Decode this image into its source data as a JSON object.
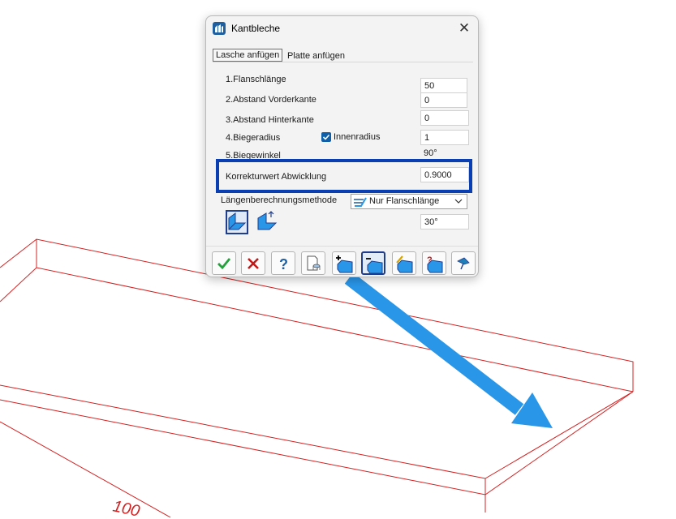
{
  "window": {
    "title": "Kantbleche",
    "close_symbol": "✕"
  },
  "tabs": [
    {
      "label": "Lasche anfügen",
      "active": true
    },
    {
      "label": "Platte anfügen",
      "active": false
    }
  ],
  "fields": {
    "flanschlaenge": {
      "label": "1.Flanschlänge",
      "value": "50"
    },
    "abstand_vorderkante": {
      "label": "2.Abstand Vorderkante",
      "value": "0"
    },
    "abstand_hinterkante": {
      "label": "3.Abstand Hinterkante",
      "value": "0"
    },
    "biegeradius": {
      "label": "4.Biegeradius",
      "value": "1"
    },
    "biegewinkel": {
      "label": "5.Biegewinkel",
      "value": "90°"
    },
    "korrekturwert": {
      "label": "Korrekturwert Abwicklung",
      "value": "0.9000"
    },
    "laengenberechnung": {
      "label": "Längenberechnungsmethode",
      "selected": "Nur Flanschlänge"
    },
    "winkel": {
      "value": "30°"
    }
  },
  "checkbox": {
    "label": "Innenradius",
    "checked": true
  },
  "drawing": {
    "dimension_label": "100"
  },
  "colors": {
    "highlight": "#0a3fb4",
    "arrow": "#2a96e8",
    "drawing_lines": "#d42020",
    "accent": "#0f5fa8"
  }
}
